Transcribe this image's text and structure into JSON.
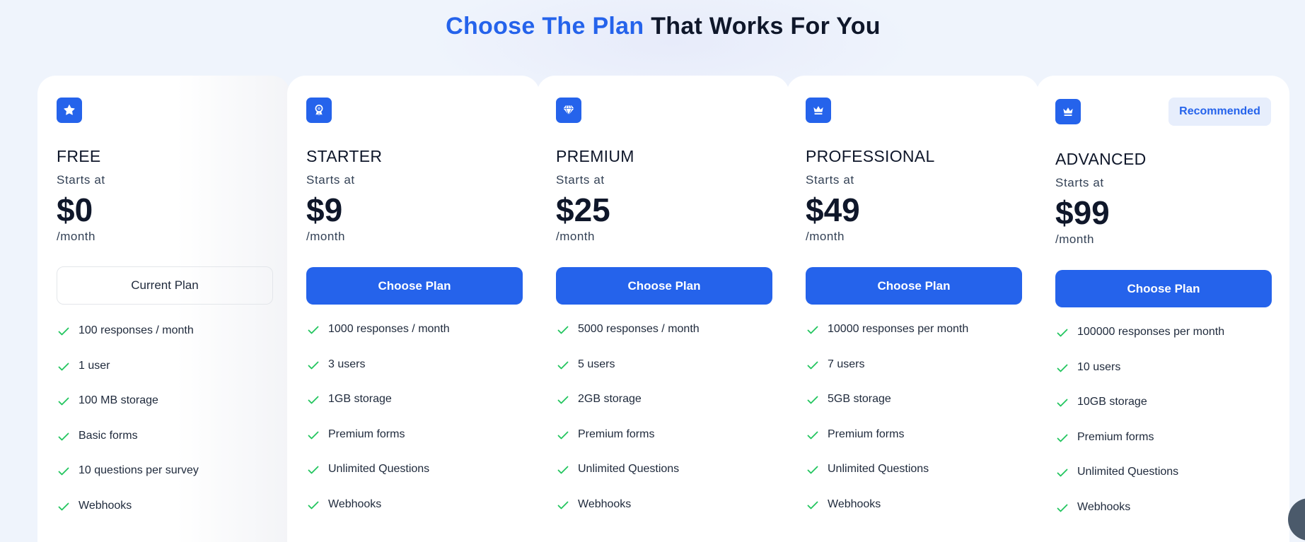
{
  "header": {
    "title_accent": "Choose The Plan",
    "title_rest": "That Works For You"
  },
  "colors": {
    "accent": "#2563eb",
    "check": "#22c55e",
    "text": "#0f172a",
    "background": "#eff4fc",
    "badge_bg": "#e7eefc"
  },
  "plans": [
    {
      "icon": "star-icon",
      "name": "FREE",
      "starts_label": "Starts at",
      "price": "$0",
      "period": "/month",
      "button_label": "Current Plan",
      "is_current": true,
      "features": [
        "100 responses / month",
        "1 user",
        "100 MB storage",
        "Basic forms",
        "10 questions per survey",
        "Webhooks"
      ]
    },
    {
      "icon": "award-ribbon-icon",
      "name": "STARTER",
      "starts_label": "Starts at",
      "price": "$9",
      "period": "/month",
      "button_label": "Choose Plan",
      "features": [
        "1000 responses / month",
        "3 users",
        "1GB storage",
        "Premium forms",
        "Unlimited Questions",
        "Webhooks"
      ]
    },
    {
      "icon": "diamond-icon",
      "name": "PREMIUM",
      "starts_label": "Starts at",
      "price": "$25",
      "period": "/month",
      "button_label": "Choose Plan",
      "features": [
        "5000 responses / month",
        "5 users",
        "2GB storage",
        "Premium forms",
        "Unlimited Questions",
        "Webhooks"
      ]
    },
    {
      "icon": "crown-icon",
      "name": "PROFESSIONAL",
      "starts_label": "Starts at",
      "price": "$49",
      "period": "/month",
      "button_label": "Choose Plan",
      "features": [
        "10000 responses per month",
        "7 users",
        "5GB storage",
        "Premium forms",
        "Unlimited Questions",
        "Webhooks"
      ]
    },
    {
      "icon": "crown-icon",
      "name": "ADVANCED",
      "badge": "Recommended",
      "starts_label": "Starts at",
      "price": "$99",
      "period": "/month",
      "button_label": "Choose Plan",
      "features": [
        "100000 responses per month",
        "10 users",
        "10GB storage",
        "Premium forms",
        "Unlimited Questions",
        "Webhooks"
      ]
    }
  ]
}
